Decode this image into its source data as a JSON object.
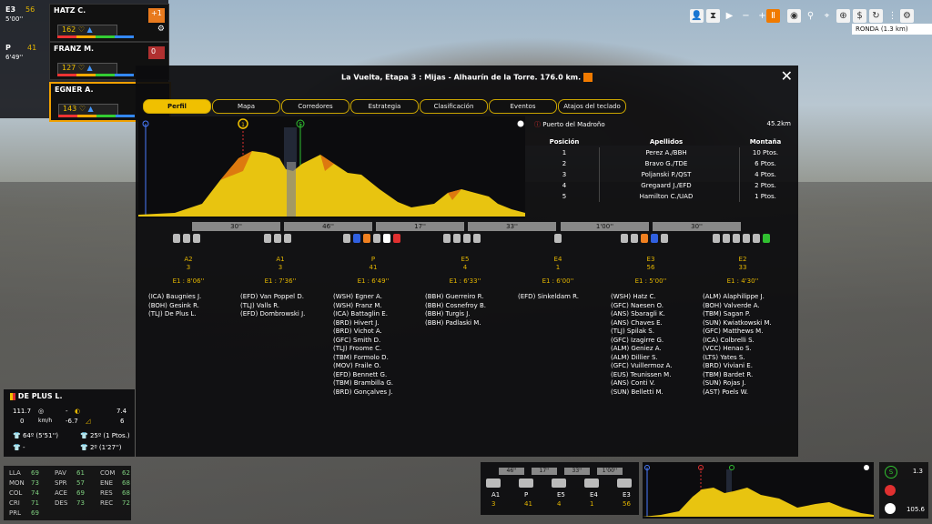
{
  "window": {
    "title": "La Vuelta, Etapa 3 : Mijas - Alhaurín de la Torre. 176.0 km."
  },
  "tabs": [
    "Perfil",
    "Mapa",
    "Corredores",
    "Estrategia",
    "Clasificación",
    "Eventos",
    "Atajos del teclado"
  ],
  "topbar": {
    "ronda": "RONDA (1.3 km)"
  },
  "riders": [
    {
      "group": "E3",
      "delta": "5'00''",
      "num": "56",
      "name": "HATZ C.",
      "energy": "162",
      "extra": "+1"
    },
    {
      "group": "P",
      "delta": "6'49''",
      "num": "41",
      "name": "FRANZ M.",
      "energy": "127",
      "extra": "0"
    },
    {
      "group": "",
      "delta": "",
      "num": "",
      "name": "EGNER A.",
      "energy": "143",
      "extra": ""
    }
  ],
  "kom": {
    "title": "Puerto del Madroño",
    "distance": "45.2km",
    "headers": [
      "Posición",
      "Apellidos",
      "Montaña"
    ],
    "rows": [
      [
        "1",
        "Perez A./BBH",
        "10 Ptos."
      ],
      [
        "2",
        "Bravo G./TDE",
        "6 Ptos."
      ],
      [
        "3",
        "Poljanski P./QST",
        "4 Ptos."
      ],
      [
        "4",
        "Gregaard J./EFD",
        "2 Ptos."
      ],
      [
        "5",
        "Hamilton C./UAD",
        "1 Ptos."
      ]
    ]
  },
  "time_gaps": [
    "30''",
    "46''",
    "17''",
    "33''",
    "1'00''",
    "30''"
  ],
  "groups": [
    {
      "code": "A2",
      "count": "3",
      "time": "E1 : 8'06''",
      "riders": [
        "(ICA) Baugnies J.",
        "(BOH) Gesink R.",
        "(TLJ) De Plus L."
      ]
    },
    {
      "code": "A1",
      "count": "3",
      "time": "E1 : 7'36''",
      "riders": [
        "(EFD) Van Poppel D.",
        "(TLJ) Valls R.",
        "(EFD) Dombrowski J."
      ]
    },
    {
      "code": "P",
      "count": "41",
      "time": "E1 : 6'49''",
      "riders": [
        "(WSH) Egner A.",
        "(WSH) Franz M.",
        "(ICA) Battaglin E.",
        "(BRD) Hivert J.",
        "(BRD) Vichot A.",
        "(GFC) Smith D.",
        "(TLJ) Froome C.",
        "(TBM) Formolo D.",
        "(MOV) Fraile O.",
        "(EFD) Bennett G.",
        "(TBM) Brambilla G.",
        "(BRD) Gonçalves J."
      ]
    },
    {
      "code": "E5",
      "count": "4",
      "time": "E1 : 6'33''",
      "riders": [
        "(BBH) Guerreiro R.",
        "(BBH) Cosnefroy B.",
        "(BBH) Turgis J.",
        "(BBH) Padlaski M."
      ]
    },
    {
      "code": "E4",
      "count": "1",
      "time": "E1 : 6'00''",
      "riders": [
        "(EFD) Sinkeldam R."
      ]
    },
    {
      "code": "E3",
      "count": "56",
      "time": "E1 : 5'00''",
      "riders": [
        "(WSH) Hatz C.",
        "(GFC) Naesen O.",
        "(ANS) Sbaragli K.",
        "(ANS) Chaves E.",
        "(TLJ) Spilak S.",
        "(GFC) Izagirre G.",
        "(ALM) Geniez A.",
        "(ALM) Dillier S.",
        "(GFC) Vuillermoz A.",
        "(EUS) Teunissen M.",
        "(ANS) Conti V.",
        "(SUN) Belletti M."
      ]
    },
    {
      "code": "E2",
      "count": "33",
      "time": "E1 : 4'30''",
      "riders": [
        "(ALM) Alaphilippe J.",
        "(BOH) Valverde A.",
        "(TBM) Sagan P.",
        "(SUN) Kwiatkowski M.",
        "(GFC) Matthews M.",
        "(ICA) Colbrelli S.",
        "(VCC) Henao S.",
        "(LTS) Yates S.",
        "(BRD) Viviani E.",
        "(TBM) Bardet R.",
        "(SUN) Rojas J.",
        "(AST) Poels W."
      ]
    }
  ],
  "player": {
    "name": "DE PLUS L.",
    "power": "111.7",
    "speed": "0",
    "speed_unit": "km/h",
    "gradient": "-6.7",
    "val_a": "7.4",
    "val_b": "6",
    "dash": "-",
    "gc_red": "64º (5'51'')",
    "gc_green": "25º (1 Ptos.)",
    "gc_blue": "-",
    "gc_white": "2º (1'27'')",
    "stats": [
      [
        "LLA",
        "69"
      ],
      [
        "PAV",
        "61"
      ],
      [
        "COM",
        "62"
      ],
      [
        "MON",
        "73"
      ],
      [
        "SPR",
        "57"
      ],
      [
        "ENE",
        "68"
      ],
      [
        "COL",
        "74"
      ],
      [
        "ACE",
        "69"
      ],
      [
        "RES",
        "68"
      ],
      [
        "CRI",
        "71"
      ],
      [
        "DES",
        "73"
      ],
      [
        "REC",
        "72"
      ],
      [
        "PRL",
        "69"
      ]
    ]
  },
  "minibar": {
    "gaps": [
      "46''",
      "17''",
      "33''",
      "1'00''"
    ],
    "groups": [
      [
        "A1",
        "3"
      ],
      [
        "P",
        "41"
      ],
      [
        "E5",
        "4"
      ],
      [
        "E4",
        "1"
      ],
      [
        "E3",
        "56"
      ]
    ]
  },
  "right_stats": {
    "sprint": "1.3",
    "finish": "105.6"
  },
  "colors": {
    "accent": "#f0c000",
    "profile": "#e8c410",
    "panel": "#0c0c0e"
  }
}
